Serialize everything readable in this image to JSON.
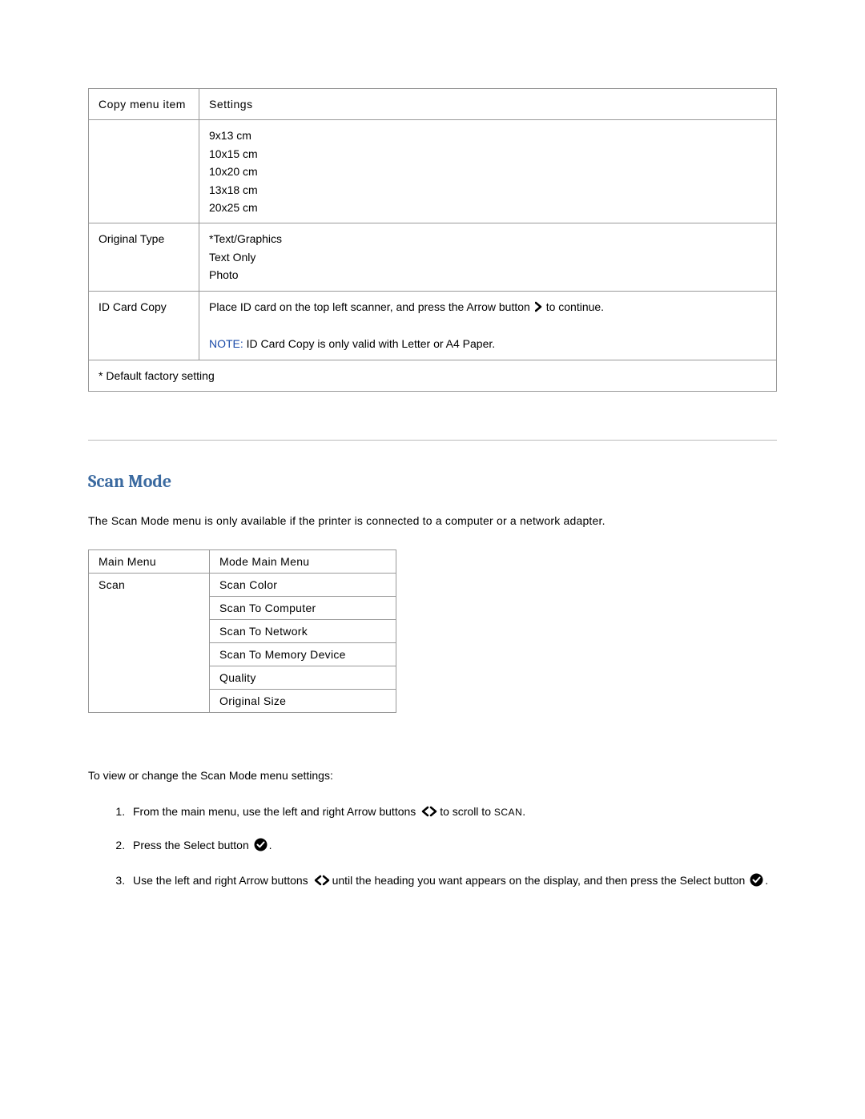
{
  "copyTable": {
    "headerLeft": "Copy menu item",
    "headerRight": "Settings",
    "sizes": [
      "9x13 cm",
      "10x15 cm",
      "10x20 cm",
      "13x18 cm",
      "20x25 cm"
    ],
    "originalType": {
      "label": "Original Type",
      "options": [
        "*Text/Graphics",
        "Text Only",
        "Photo"
      ]
    },
    "idCardCopy": {
      "label": "ID Card Copy",
      "textBefore": "Place ID card on the top left scanner, and press the Arrow button ",
      "textAfter": "to continue.",
      "noteLabel": "NOTE:",
      "noteText": " ID Card Copy is only valid with Letter or A4 Paper."
    },
    "footnote": "*  Default factory setting"
  },
  "scanSection": {
    "title": "Scan Mode",
    "intro": "The Scan Mode menu is only available if the printer is connected to a computer or a network adapter.",
    "table": {
      "headerLeft": "Main Menu",
      "headerRight": "Mode Main Menu",
      "leftValue": "Scan",
      "items": [
        "Scan Color",
        "Scan To Computer",
        "Scan To Network",
        "Scan To Memory Device",
        "Quality",
        "Original Size"
      ]
    },
    "instructionsLead": "To view or change the Scan Mode menu settings:",
    "steps": {
      "s1_before": "From the main menu, use the left and right Arrow buttons ",
      "s1_after": "to scroll to ",
      "s1_target": "SCAN",
      "s1_period": ".",
      "s2_before": "Press the Select button ",
      "s2_period": ".",
      "s3_before": "Use the left and right Arrow buttons ",
      "s3_mid": "until the heading you want appears on the display, and then press the Select button ",
      "s3_period": "."
    }
  }
}
